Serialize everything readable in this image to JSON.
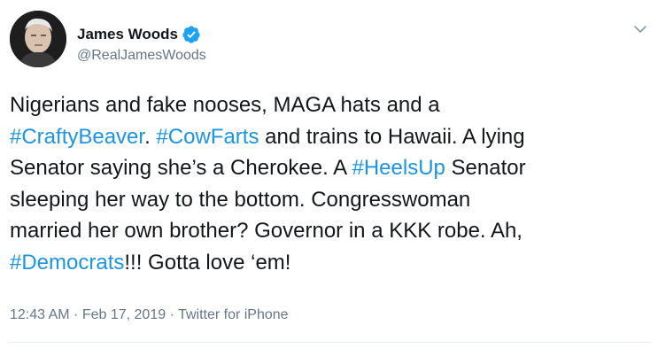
{
  "author": {
    "name": "James Woods",
    "handle": "@RealJamesWoods",
    "verified": true
  },
  "tweet": {
    "lines": [
      [
        {
          "text": "Nigerians and fake nooses, MAGA hats and a",
          "type": "text"
        }
      ],
      [
        {
          "text": "#CraftyBeaver",
          "type": "hashtag"
        },
        {
          "text": ". ",
          "type": "text"
        },
        {
          "text": "#CowFarts",
          "type": "hashtag"
        },
        {
          "text": " and trains to Hawaii. A lying",
          "type": "text"
        }
      ],
      [
        {
          "text": "Senator saying she’s a Cherokee. A ",
          "type": "text"
        },
        {
          "text": "#HeelsUp",
          "type": "hashtag"
        },
        {
          "text": " Senator",
          "type": "text"
        }
      ],
      [
        {
          "text": "sleeping her way to the bottom. Congresswoman",
          "type": "text"
        }
      ],
      [
        {
          "text": "married her own brother? Governor in a KKK robe. Ah,",
          "type": "text"
        }
      ],
      [
        {
          "text": "#Democrats",
          "type": "hashtag"
        },
        {
          "text": "!!! Gotta love ‘em!",
          "type": "text"
        }
      ]
    ]
  },
  "meta": {
    "time": "12:43 AM",
    "separator1": " · ",
    "date": "Feb 17, 2019",
    "separator2": " · ",
    "source": "Twitter for iPhone"
  },
  "colors": {
    "hashtag": "#1b95e0",
    "verified": "#1da1f2",
    "secondary_text": "#657786",
    "primary_text": "#14171a"
  },
  "icons": {
    "verified": "verified-badge-icon",
    "menu": "chevron-down-icon"
  }
}
